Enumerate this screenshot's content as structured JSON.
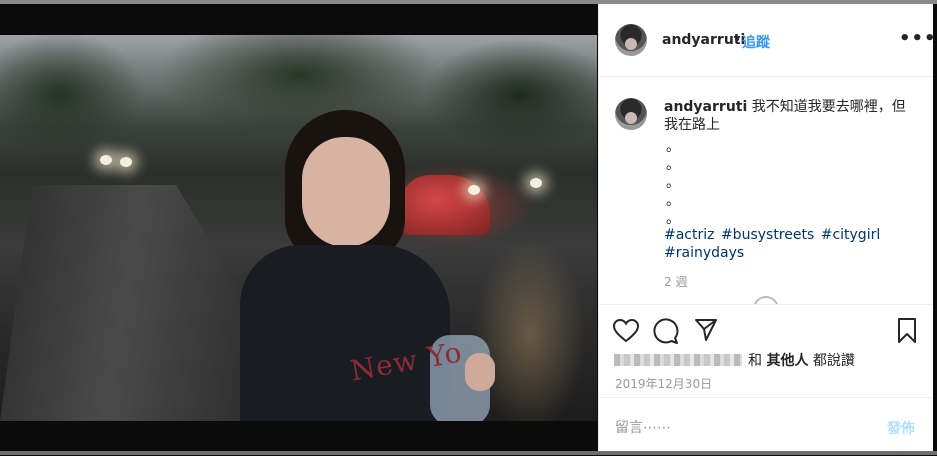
{
  "post": {
    "username": "andyarruti",
    "dot": "•",
    "follow_label": "追蹤",
    "more_label": "•••",
    "shirt_text": "New Yo",
    "caption": {
      "username": "andyarruti",
      "text": "我不知道我要去哪裡，但我在路上",
      "bullets": [
        "。",
        "。",
        "。",
        "。",
        "。"
      ],
      "hashtags": [
        "#actriz",
        "#busystreets",
        "#citygirl",
        "#rainydays"
      ],
      "age": "2 週"
    },
    "likes": {
      "connector": "和",
      "others": "其他人",
      "suffix": "都說讚"
    },
    "date": "2019年12月30日",
    "comment": {
      "placeholder": "留言⋯⋯",
      "post_label": "發佈"
    }
  },
  "icons": [
    "heart-icon",
    "comment-icon",
    "share-icon",
    "bookmark-icon",
    "more-options-icon"
  ],
  "colors": {
    "link": "#003569",
    "follow": "#3897f0",
    "post_disabled": "#b2dffc",
    "text": "#262626",
    "muted": "#999999"
  }
}
